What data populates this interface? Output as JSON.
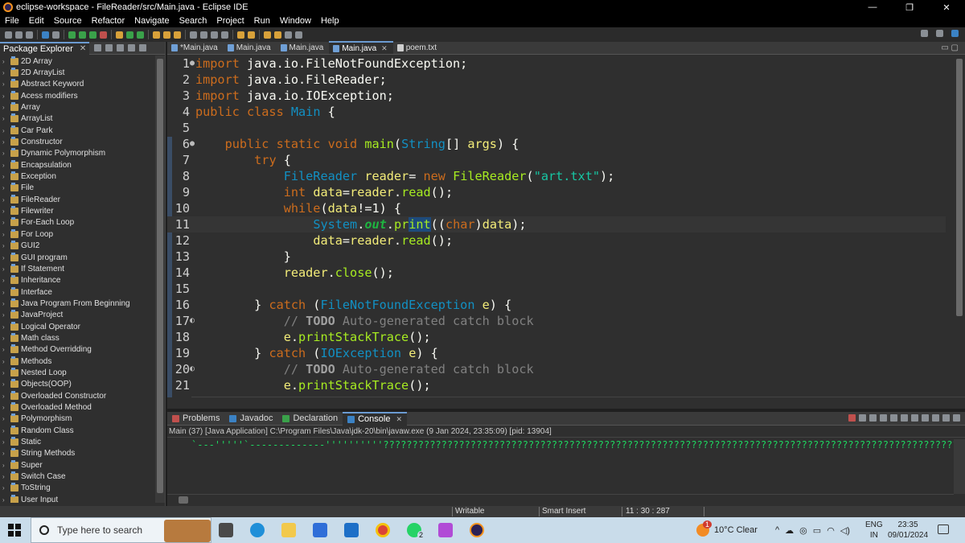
{
  "window": {
    "title": "eclipse-workspace - FileReader/src/Main.java - Eclipse IDE",
    "minimize": "—",
    "maximize": "❐",
    "close": "✕"
  },
  "menu": [
    "File",
    "Edit",
    "Source",
    "Refactor",
    "Navigate",
    "Search",
    "Project",
    "Run",
    "Window",
    "Help"
  ],
  "package_explorer": {
    "title": "Package Explorer",
    "close": "✕",
    "items": [
      "2D Array",
      "2D ArrayList",
      "Abstract Keyword",
      "Acess modifiers",
      "Array",
      "ArrayList",
      "Car Park",
      "Constructor",
      "Dynamic Polymorphism",
      "Encapsulation",
      "Exception",
      "File",
      "FileReader",
      "Filewriter",
      "For-Each Loop",
      "For Loop",
      "GUI2",
      "GUI program",
      "If Statement",
      "Inheritance",
      "Interface",
      "Java Program From Beginning",
      "JavaProject",
      "Logical Operator",
      "Math class",
      "Method Overridding",
      "Methods",
      "Nested Loop",
      "Objects(OOP)",
      "Overloaded Constructor",
      "Overloaded Method",
      "Polymorphism",
      "Random Class",
      "Static",
      "String Methods",
      "Super",
      "Switch Case",
      "ToString",
      "User Input"
    ]
  },
  "editor": {
    "tabs": [
      {
        "label": "*Main.java",
        "type": "java"
      },
      {
        "label": "Main.java",
        "type": "java"
      },
      {
        "label": "Main.java",
        "type": "java"
      },
      {
        "label": "Main.java",
        "type": "java",
        "active": true
      },
      {
        "label": "poem.txt",
        "type": "txt"
      }
    ],
    "tab_close": "✕",
    "lines": [
      {
        "n": "1",
        "mark": "●",
        "tokens": [
          [
            "k",
            "import"
          ],
          [
            "p",
            " java.io.FileNotFoundException;"
          ]
        ]
      },
      {
        "n": "2",
        "tokens": [
          [
            "k",
            "import"
          ],
          [
            "p",
            " java.io.FileReader;"
          ]
        ]
      },
      {
        "n": "3",
        "tokens": [
          [
            "k",
            "import"
          ],
          [
            "p",
            " java.io.IOException;"
          ]
        ]
      },
      {
        "n": "4",
        "tokens": [
          [
            "k",
            "public class"
          ],
          [
            "p",
            " "
          ],
          [
            "t",
            "Main"
          ],
          [
            "p",
            " {"
          ]
        ]
      },
      {
        "n": "5",
        "tokens": []
      },
      {
        "n": "6",
        "mark": "●",
        "tokens": [
          [
            "p",
            "    "
          ],
          [
            "k",
            "public static void"
          ],
          [
            "p",
            " "
          ],
          [
            "m",
            "main"
          ],
          [
            "p",
            "("
          ],
          [
            "t",
            "String"
          ],
          [
            "p",
            "[] "
          ],
          [
            "v",
            "args"
          ],
          [
            "p",
            ") {"
          ]
        ]
      },
      {
        "n": "7",
        "tokens": [
          [
            "p",
            "        "
          ],
          [
            "k",
            "try"
          ],
          [
            "p",
            " {"
          ]
        ]
      },
      {
        "n": "8",
        "tokens": [
          [
            "p",
            "            "
          ],
          [
            "t",
            "FileReader"
          ],
          [
            "p",
            " "
          ],
          [
            "v",
            "reader"
          ],
          [
            "p",
            "= "
          ],
          [
            "k",
            "new"
          ],
          [
            "p",
            " "
          ],
          [
            "m",
            "FileReader"
          ],
          [
            "p",
            "("
          ],
          [
            "s",
            "\"art.txt\""
          ],
          [
            "p",
            ");"
          ]
        ]
      },
      {
        "n": "9",
        "tokens": [
          [
            "p",
            "            "
          ],
          [
            "k",
            "int"
          ],
          [
            "p",
            " "
          ],
          [
            "v",
            "data"
          ],
          [
            "p",
            "="
          ],
          [
            "v",
            "reader"
          ],
          [
            "p",
            "."
          ],
          [
            "m",
            "read"
          ],
          [
            "p",
            "();"
          ]
        ]
      },
      {
        "n": "10",
        "tokens": [
          [
            "p",
            "            "
          ],
          [
            "k",
            "while"
          ],
          [
            "p",
            "("
          ],
          [
            "v",
            "data"
          ],
          [
            "p",
            "!=1) {"
          ]
        ]
      },
      {
        "n": "11",
        "current": true,
        "tokens": [
          [
            "p",
            "                "
          ],
          [
            "t",
            "System"
          ],
          [
            "p",
            "."
          ],
          [
            "ti",
            "out"
          ],
          [
            "p",
            "."
          ],
          [
            "m",
            "pr"
          ],
          [
            "msel",
            "int"
          ],
          [
            "p",
            "(("
          ],
          [
            "k",
            "char"
          ],
          [
            "p",
            ")"
          ],
          [
            "v",
            "data"
          ],
          [
            "p",
            ");"
          ]
        ]
      },
      {
        "n": "12",
        "tokens": [
          [
            "p",
            "                "
          ],
          [
            "v",
            "data"
          ],
          [
            "p",
            "="
          ],
          [
            "v",
            "reader"
          ],
          [
            "p",
            "."
          ],
          [
            "m",
            "read"
          ],
          [
            "p",
            "();"
          ]
        ]
      },
      {
        "n": "13",
        "tokens": [
          [
            "p",
            "            }"
          ]
        ]
      },
      {
        "n": "14",
        "tokens": [
          [
            "p",
            "            "
          ],
          [
            "v",
            "reader"
          ],
          [
            "p",
            "."
          ],
          [
            "m",
            "close"
          ],
          [
            "p",
            "();"
          ]
        ]
      },
      {
        "n": "15",
        "tokens": []
      },
      {
        "n": "16",
        "tokens": [
          [
            "p",
            "        } "
          ],
          [
            "k",
            "catch"
          ],
          [
            "p",
            " ("
          ],
          [
            "t",
            "FileNotFoundException"
          ],
          [
            "p",
            " "
          ],
          [
            "v",
            "e"
          ],
          [
            "p",
            ") {"
          ]
        ]
      },
      {
        "n": "17",
        "mark": "◐",
        "tokens": [
          [
            "p",
            "            "
          ],
          [
            "c",
            "// "
          ],
          [
            "todo",
            "TODO"
          ],
          [
            "c",
            " Auto-generated catch block"
          ]
        ]
      },
      {
        "n": "18",
        "tokens": [
          [
            "p",
            "            "
          ],
          [
            "v",
            "e"
          ],
          [
            "p",
            "."
          ],
          [
            "m",
            "printStackTrace"
          ],
          [
            "p",
            "();"
          ]
        ]
      },
      {
        "n": "19",
        "tokens": [
          [
            "p",
            "        } "
          ],
          [
            "k",
            "catch"
          ],
          [
            "p",
            " ("
          ],
          [
            "t",
            "IOException"
          ],
          [
            "p",
            " "
          ],
          [
            "v",
            "e"
          ],
          [
            "p",
            ") {"
          ]
        ]
      },
      {
        "n": "20",
        "mark": "◐",
        "tokens": [
          [
            "p",
            "            "
          ],
          [
            "c",
            "// "
          ],
          [
            "todo",
            "TODO"
          ],
          [
            "c",
            " Auto-generated catch block"
          ]
        ]
      },
      {
        "n": "21",
        "tokens": [
          [
            "p",
            "            "
          ],
          [
            "v",
            "e"
          ],
          [
            "p",
            "."
          ],
          [
            "m",
            "printStackTrace"
          ],
          [
            "p",
            "();"
          ]
        ]
      }
    ]
  },
  "console": {
    "tabs": [
      {
        "label": "Problems",
        "icon": "r"
      },
      {
        "label": "Javadoc",
        "icon": "b"
      },
      {
        "label": "Declaration",
        "icon": "g"
      },
      {
        "label": "Console",
        "icon": "b",
        "active": true
      }
    ],
    "close": "✕",
    "status": "Main (37) [Java Application] C:\\Program Files\\Java\\jdk-20\\bin\\javaw.exe  (9 Jan 2024, 23:35:09) [pid: 13904]",
    "output": "`---'''''`-------------''''''''''???????????????????????????????????????????????????????????????????????????????????????????????????"
  },
  "statusbar": {
    "mode": "Writable",
    "insert": "Smart Insert",
    "position": "11 : 30 : 287"
  },
  "taskbar": {
    "search_placeholder": "Type here to search",
    "weather": "10°C  Clear",
    "lang_top": "ENG",
    "lang_bottom": "IN",
    "time": "23:35",
    "date": "09/01/2024",
    "whatsapp_badge": "2",
    "weather_badge": "1"
  },
  "colors": {
    "accent": "#6b9bd1",
    "editor_bg": "#2f2f2f",
    "console_text": "#1ed760"
  }
}
